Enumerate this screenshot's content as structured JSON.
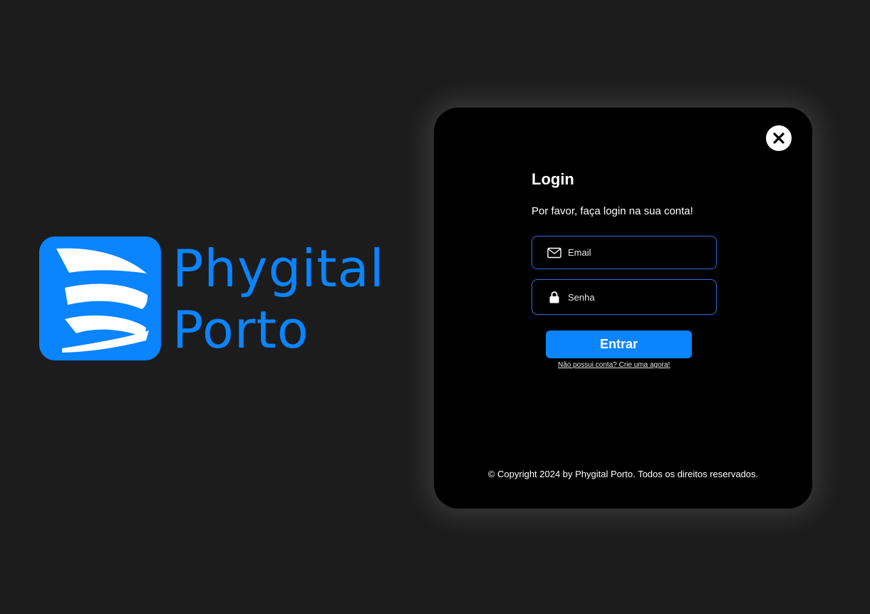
{
  "brand": {
    "line1": "Phygital",
    "line2": "Porto",
    "color": "#0a84ff"
  },
  "login": {
    "title": "Login",
    "subtitle": "Por favor, faça login na sua conta!",
    "email_placeholder": "Email",
    "password_placeholder": "Senha",
    "submit_label": "Entrar",
    "signup_link": "Não possui conta? Crie uma agora!",
    "close_icon": "close-icon",
    "email_icon": "mail-icon",
    "password_icon": "lock-icon"
  },
  "footer": {
    "copyright": "© Copyright 2024 by Phygital Porto. Todos os direitos reservados."
  },
  "colors": {
    "background": "#1c1c1c",
    "card": "#000000",
    "accent": "#0a84ff",
    "field_border": "#2f6fd8"
  }
}
